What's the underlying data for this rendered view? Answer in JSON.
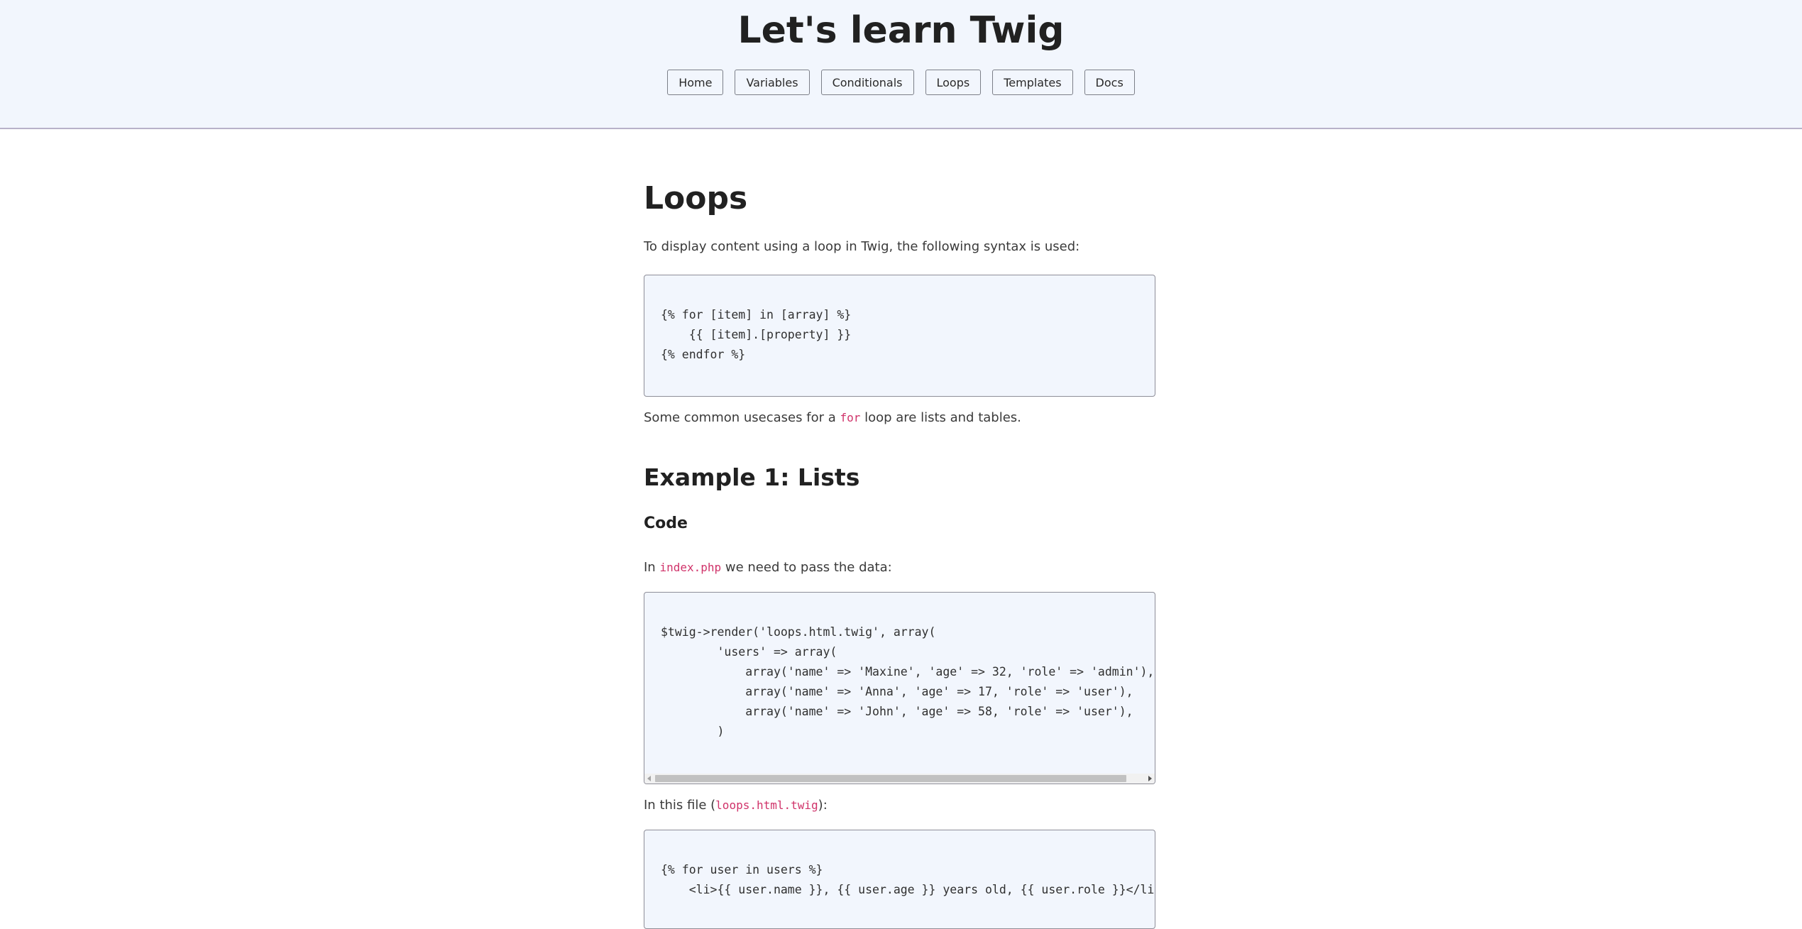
{
  "header": {
    "title": "Let's learn Twig",
    "nav": [
      "Home",
      "Variables",
      "Conditionals",
      "Loops",
      "Templates",
      "Docs"
    ]
  },
  "main": {
    "title": "Loops",
    "intro": "To display content using a loop in Twig, the following syntax is used:",
    "syntax_code": "{% for [item] in [array] %}\n    {{ [item].[property] }}\n{% endfor %}",
    "usecases": {
      "before": "Some common usecases for a ",
      "code": "for",
      "after": " loop are lists and tables."
    },
    "example1": {
      "heading": "Example 1: Lists",
      "code_heading": "Code",
      "php_intro": {
        "before": "In ",
        "code": "index.php",
        "after": " we need to pass the data:"
      },
      "php_code": "$twig->render('loops.html.twig', array(\n        'users' => array(\n            array('name' => 'Maxine', 'age' => 32, 'role' => 'admin'),\n            array('name' => 'Anna', 'age' => 17, 'role' => 'user'),\n            array('name' => 'John', 'age' => 58, 'role' => 'user'),\n        )\n",
      "twig_intro": {
        "before": "In this file (",
        "code": "loops.html.twig",
        "after": "):"
      },
      "twig_code": "{% for user in users %}\n    <li>{{ user.name }}, {{ user.age }} years old, {{ user.role }}</li>"
    }
  }
}
